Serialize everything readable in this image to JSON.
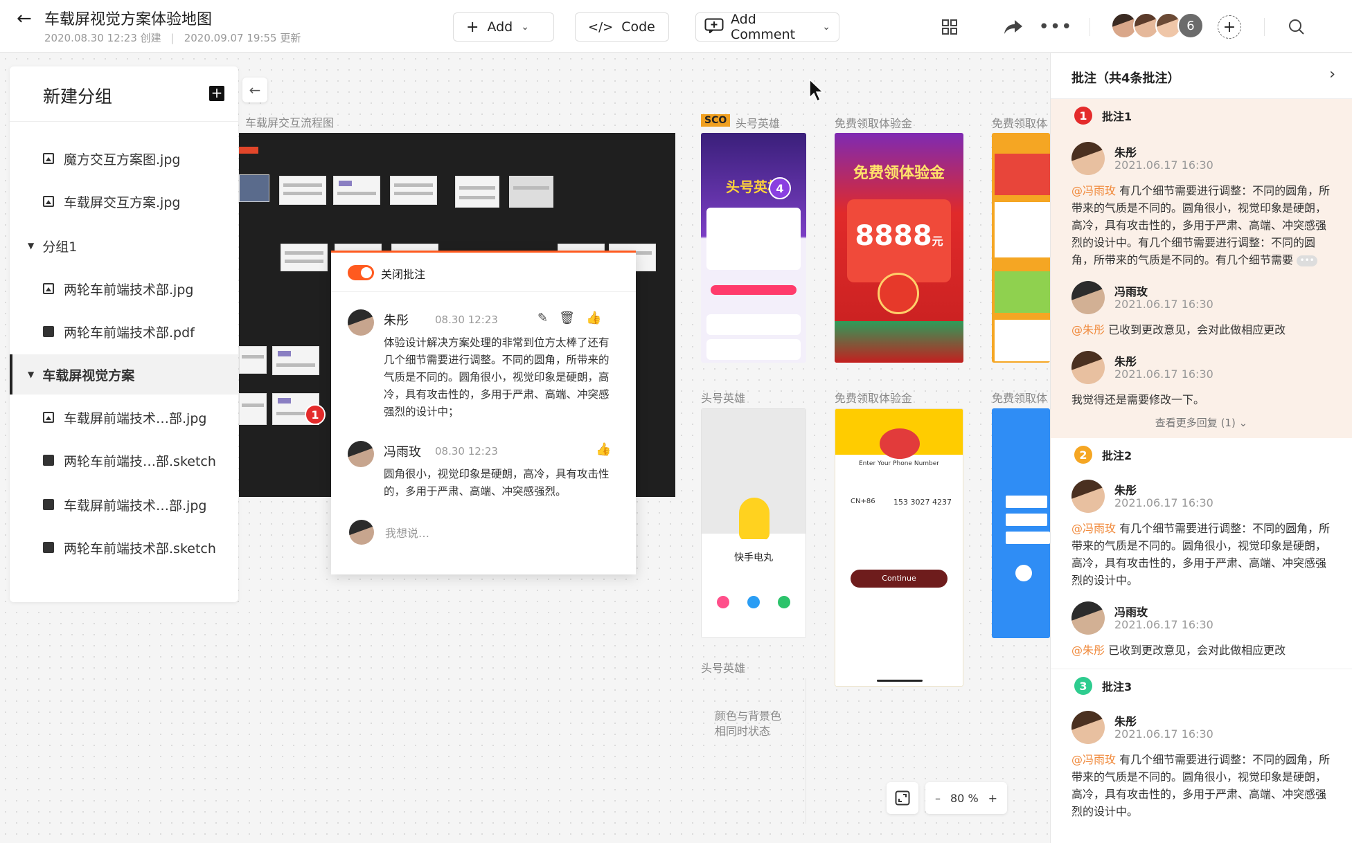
{
  "header": {
    "title": "车载屏视觉方案体验地图",
    "created": "2020.08.30 12:23 创建",
    "updated": "2020.09.07 19:55 更新",
    "add_label": "Add",
    "code_label": "Code",
    "comment_label": "Add Comment",
    "collab_count": "6"
  },
  "sidebar": {
    "title": "新建分组",
    "items": [
      {
        "label": "魔方交互方案图.jpg",
        "type": "image"
      },
      {
        "label": "车载屏交互方案.jpg",
        "type": "image"
      },
      {
        "label": "分组1",
        "type": "group"
      },
      {
        "label": "两轮车前端技术部.jpg",
        "type": "image"
      },
      {
        "label": "两轮车前端技术部.pdf",
        "type": "doc"
      },
      {
        "label": "车载屏视觉方案",
        "type": "group-active"
      },
      {
        "label": "车载屏前端技术…部.jpg",
        "type": "image"
      },
      {
        "label": "两轮车前端技…部.sketch",
        "type": "doc"
      },
      {
        "label": "车载屏前端技术…部.jpg",
        "type": "doc"
      },
      {
        "label": "两轮车前端技术部.sketch",
        "type": "doc"
      }
    ]
  },
  "canvas": {
    "labels": {
      "flow": "车载屏交互流程图",
      "sco": "SCO",
      "hero1": "头号英雄",
      "free1": "免费领取体验金",
      "free1b": "免费领取体",
      "hero2": "头号英雄",
      "free2": "免费领取体验金",
      "free2b": "免费领取体",
      "hero3": "头号英雄"
    },
    "pin_badge": "1",
    "phone_badge": "4",
    "note": "颜色与背景色\n相同时状态",
    "zoom": "80 %",
    "phone_texts": {
      "hero_title": "头号英雄",
      "free_title": "免费领体验金",
      "amount": "8888",
      "amount_unit": "元",
      "kuaishou": "快手电丸",
      "phone_prompt": "Enter Your Phone Number",
      "phone_num": "153 3027 4237",
      "country": "CN+86",
      "continue": "Continue"
    }
  },
  "popup": {
    "toggle_label": "关闭批注",
    "c1": {
      "name": "朱彤",
      "time": "08.30 12:23",
      "text": "体验设计解决方案处理的非常到位方太棒了还有几个细节需要进行调整。不同的圆角，所带来的气质是不同的。圆角很小，视觉印象是硬朗，高冷，具有攻击性的，多用于严肃、高端、冲突感强烈的设计中；"
    },
    "c2": {
      "name": "冯雨玫",
      "time": "08.30 12:23",
      "text": "圆角很小，视觉印象是硬朗，高冷，具有攻击性的，多用于严肃、高端、冲突感强烈。"
    },
    "placeholder": "我想说…"
  },
  "panel": {
    "title": "批注（共4条批注）",
    "groups": [
      {
        "num": "1",
        "label": "批注1",
        "color": "#e42b2b",
        "comments": [
          {
            "name": "朱彤",
            "time": "2021.06.17 16:30",
            "at": "@冯雨玫",
            "text": " 有几个细节需要进行调整：不同的圆角，所带来的气质是不同的。圆角很小，视觉印象是硬朗，高冷，具有攻击性的，多用于严肃、高端、冲突感强烈的设计中。有几个细节需要进行调整：不同的圆角，所带来的气质是不同的。有几个细节需要"
          },
          {
            "name": "冯雨玫",
            "time": "2021.06.17 16:30",
            "at": "@朱彤",
            "text": " 已收到更改意见，会对此做相应更改"
          },
          {
            "name": "朱彤",
            "time": "2021.06.17 16:30",
            "at": "",
            "text": "我觉得还是需要修改一下。"
          }
        ],
        "more": "查看更多回复 (1)"
      },
      {
        "num": "2",
        "label": "批注2",
        "color": "#f5a623",
        "comments": [
          {
            "name": "朱彤",
            "time": "2021.06.17 16:30",
            "at": "@冯雨玫",
            "text": " 有几个细节需要进行调整：不同的圆角，所带来的气质是不同的。圆角很小，视觉印象是硬朗，高冷，具有攻击性的，多用于严肃、高端、冲突感强烈的设计中。"
          },
          {
            "name": "冯雨玫",
            "time": "2021.06.17 16:30",
            "at": "@朱彤",
            "text": " 已收到更改意见，会对此做相应更改"
          }
        ]
      },
      {
        "num": "3",
        "label": "批注3",
        "color": "#2ecc8f",
        "comments": [
          {
            "name": "朱彤",
            "time": "2021.06.17 16:30",
            "at": "@冯雨玫",
            "text": " 有几个细节需要进行调整：不同的圆角，所带来的气质是不同的。圆角很小，视觉印象是硬朗，高冷，具有攻击性的，多用于严肃、高端、冲突感强烈的设计中。"
          }
        ]
      }
    ]
  }
}
